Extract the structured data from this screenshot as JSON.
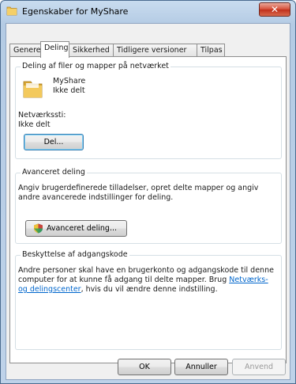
{
  "window": {
    "title": "Egenskaber for MyShare",
    "close_icon": "close-icon"
  },
  "tabs": [
    {
      "label": "Generelt"
    },
    {
      "label": "Deling"
    },
    {
      "label": "Sikkerhed"
    },
    {
      "label": "Tidligere versioner"
    },
    {
      "label": "Tilpas"
    }
  ],
  "sharing": {
    "group_title": "Deling af filer og mapper på netværket",
    "folder_name": "MyShare",
    "folder_status": "Ikke delt",
    "network_path_label": "Netværkssti:",
    "network_path_value": "Ikke delt",
    "share_button": "Del..."
  },
  "advanced": {
    "group_title": "Avanceret deling",
    "description": "Angiv brugerdefinerede tilladelser, opret delte mapper og angiv andre avancerede indstillinger for deling.",
    "button": "Avanceret deling..."
  },
  "password": {
    "group_title": "Beskyttelse af adgangskode",
    "text_before": "Andre personer skal have en brugerkonto og adgangskode til denne computer for at kunne få adgang til delte mapper. Brug ",
    "link": "Netværks- og delingscenter",
    "text_after": ", hvis du vil ændre denne indstilling."
  },
  "buttons": {
    "ok": "OK",
    "cancel": "Annuller",
    "apply": "Anvend"
  },
  "colors": {
    "link": "#0066cc",
    "titlebar": "#c9dcef",
    "close_button": "#c0301b"
  }
}
